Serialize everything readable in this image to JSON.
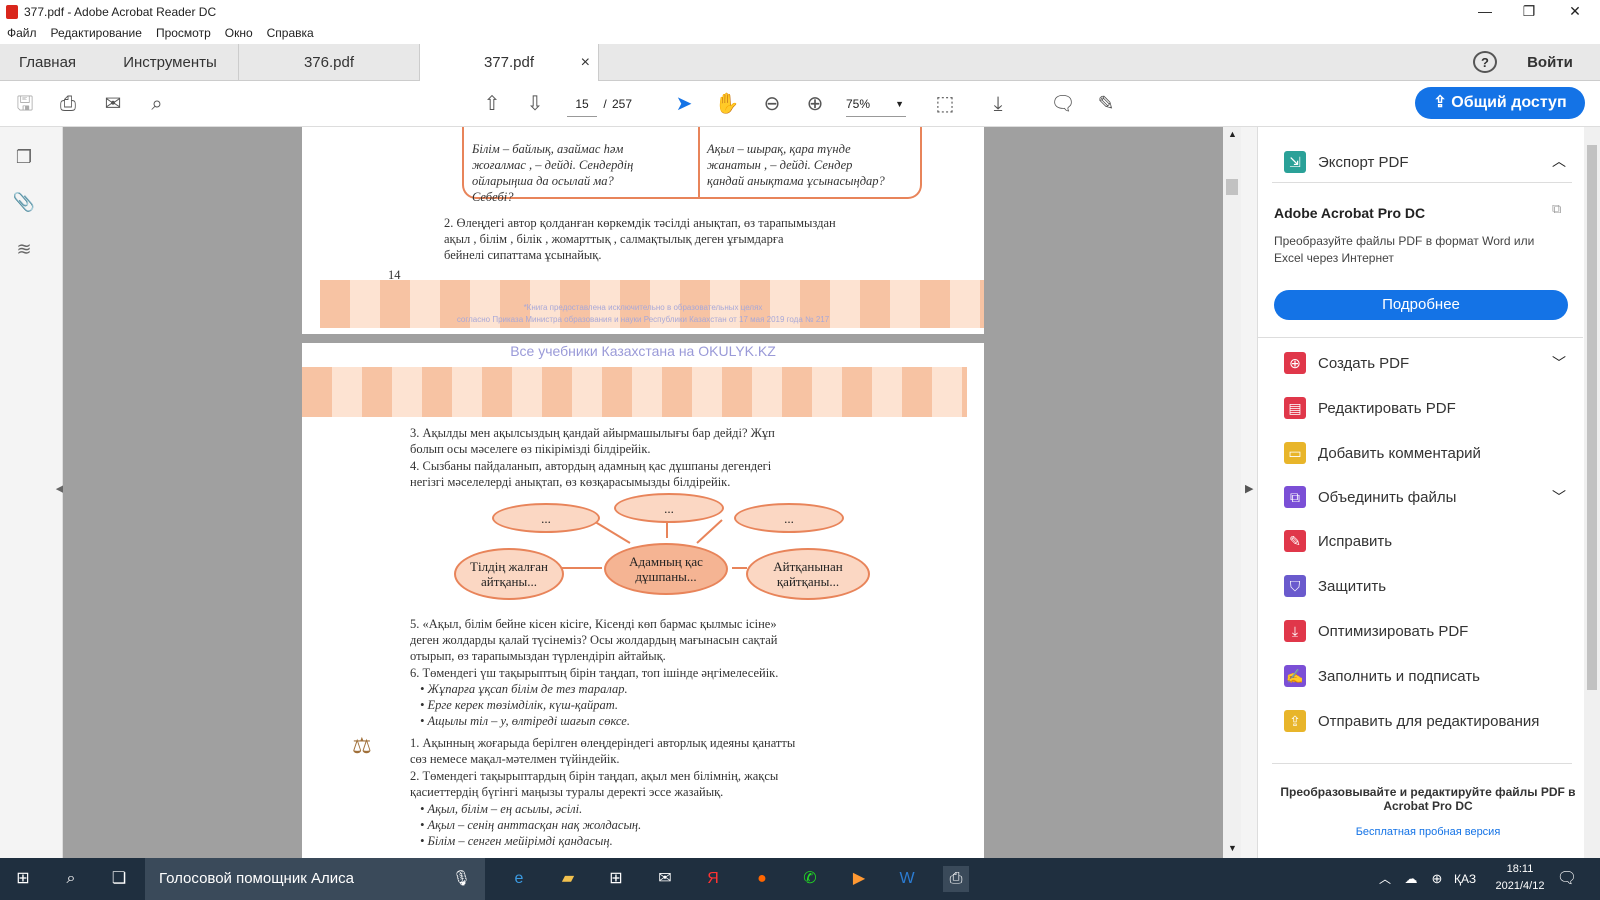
{
  "window": {
    "title": "377.pdf - Adobe Acrobat Reader DC",
    "minimize": "—",
    "maximize": "❐",
    "close": "✕"
  },
  "menu": [
    "Файл",
    "Редактирование",
    "Просмотр",
    "Окно",
    "Справка"
  ],
  "tabs": {
    "home": "Главная",
    "tools": "Инструменты",
    "doc1": "376.pdf",
    "doc2": "377.pdf",
    "close": "×",
    "help": "?",
    "signin": "Войти"
  },
  "toolbar": {
    "page_current": "15",
    "page_sep": "/",
    "page_total": "257",
    "zoom": "75%",
    "share": "Общий доступ"
  },
  "page1": {
    "box_left": [
      "Білім – байлық, азаймас һәм",
      "жоғалмас , – дейді. Сендердің",
      "ойларыңша да осылай ма?",
      "Себебі?"
    ],
    "box_right": [
      "Ақыл – шырақ, қара түнде",
      "жанатын , – дейді. Сендер",
      "қандай анықтама ұсынасыңдар?"
    ],
    "q2": [
      "2. Өлеңдегі автор қолданған көркемдік тәсілді анықтап, өз тарапымыздан",
      "ақыл , білім , білік , жомарттық , салмақтылық деген ұғымдарға",
      "бейнелі сипаттама ұсынайық."
    ],
    "page_number": "14",
    "footer1": "*Книга предоставлена исключительно в образовательных целях",
    "footer2": "согласно Приказа Министра образования и науки Республики Казахстан от 17 мая 2019 года № 217"
  },
  "watermark": "Все учебники Казахстана на OKULYK.KZ",
  "page2": {
    "q3": [
      "3. Ақылды мен ақылсыздың қандай айырмашылығы бар дейді? Жұп",
      "болып осы мәселеге өз пікірімізді білдірейік."
    ],
    "q4": [
      "4. Сызбаны пайдаланып, автордың адамның қас дұшпаны дегендегі",
      "негізгі мәселелерді анықтап, өз көзқарасымызды білдірейік."
    ],
    "diagram": {
      "top_left": "...",
      "top_center": "...",
      "top_right": "...",
      "left": "Тілдің жалған айтқаны...",
      "center": "Адамның қас дұшпаны...",
      "right": "Айтқанынан қайтқаны..."
    },
    "q5": [
      "5. «Ақыл, білім бейне кісен кісіге, Кісенді көп бармас қылмыс ісіне»",
      "деген жолдарды қалай түсінеміз? Осы жолдардың мағынасын сақтай",
      "отырып, өз тарапымыздан түрлендіріп айтайық."
    ],
    "q6": "6. Төмендегі үш тақырыптың бірін таңдап, топ ішінде әңгімелесейік.",
    "q6_items": [
      "• Жұпарға ұқсап білім де тез таралар.",
      "• Ерге керек төзімділік, күш-қайрат.",
      "• Ащылы тіл – у, өлтіреді шағып сөксе."
    ],
    "t1": [
      "1. Ақынның жоғарыда берілген өлеңдеріндегі авторлық идеяны қанатты",
      "сөз немесе мақал-мәтелмен түйіндейік."
    ],
    "t2": [
      "2. Төмендегі тақырыптардың бірін таңдап, ақыл мен білімнің, жақсы",
      "қасиеттердің бүгінгі маңызы туралы деректі эссе жазайық."
    ],
    "t2_items": [
      "• Ақыл, білім – ең асылы, әсілі.",
      "• Ақыл – сенің анттасқан нақ жолдасың.",
      "• Білім – сенген мейірімді қандасың."
    ]
  },
  "right_panel": {
    "export": "Экспорт PDF",
    "pro_title": "Adobe Acrobat Pro DC",
    "pro_desc": "Преобразуйте файлы PDF в формат Word или Excel через Интернет",
    "more": "Подробнее",
    "items": [
      "Создать PDF",
      "Редактировать PDF",
      "Добавить комментарий",
      "Объединить файлы",
      "Исправить",
      "Защитить",
      "Оптимизировать PDF",
      "Заполнить и подписать",
      "Отправить для редактирования"
    ],
    "item_colors": [
      "#e0374a",
      "#e0374a",
      "#e8b52a",
      "#7b4fd6",
      "#e0374a",
      "#6a5acd",
      "#e0374a",
      "#7b4fd6",
      "#e8b52a"
    ],
    "promo": "Преобразовывайте и редактируйте файлы PDF в Acrobat Pro DC",
    "trial": "Бесплатная пробная версия"
  },
  "taskbar": {
    "assistant": "Голосовой помощник Алиса",
    "lang": "ҚАЗ",
    "time": "18:11",
    "date": "2021/4/12"
  }
}
